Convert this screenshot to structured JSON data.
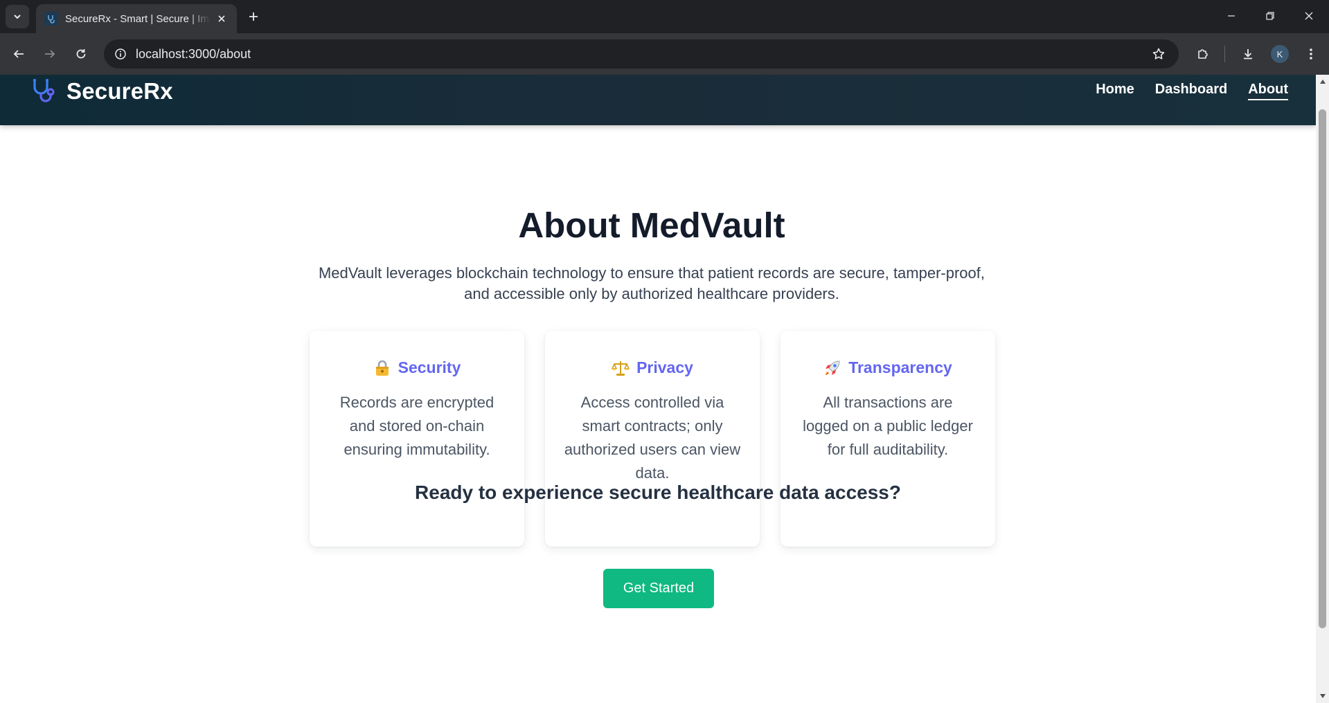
{
  "browser": {
    "tab_title": "SecureRx - Smart | Secure | Immutable",
    "url": "localhost:3000/about",
    "profile_initial": "K"
  },
  "site": {
    "brand": "SecureRx",
    "nav": [
      {
        "label": "Home",
        "active": false
      },
      {
        "label": "Dashboard",
        "active": false
      },
      {
        "label": "About",
        "active": true
      }
    ]
  },
  "hero": {
    "title": "About MedVault",
    "description": "MedVault leverages blockchain technology to ensure that patient records are secure, tamper-proof, and accessible only by authorized healthcare providers."
  },
  "features": [
    {
      "icon": "lock-emoji-icon",
      "title": "Security",
      "text": "Records are encrypted and stored on-chain ensuring immutability."
    },
    {
      "icon": "balance-scale-emoji-icon",
      "title": "Privacy",
      "text": "Access controlled via smart contracts; only authorized users can view data."
    },
    {
      "icon": "rocket-emoji-icon",
      "title": "Transparency",
      "text": "All transactions are logged on a public ledger for full auditability."
    }
  ],
  "cta": {
    "text": "Ready to experience secure healthcare data access?",
    "button_label": "Get Started"
  },
  "colors": {
    "accent": "#6366f1",
    "cta_button": "#10b981",
    "header_bg": "#1b2c39"
  }
}
